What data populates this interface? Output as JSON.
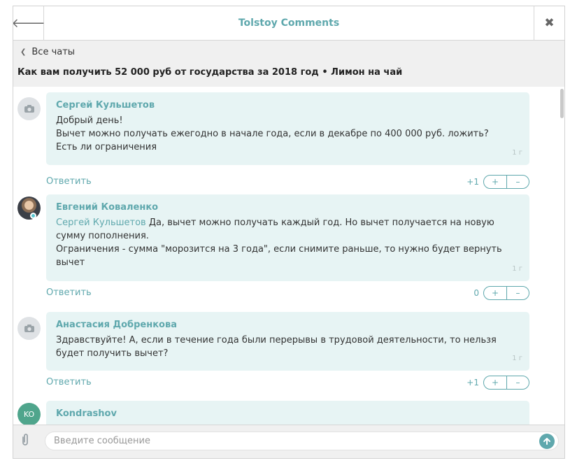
{
  "titlebar": {
    "back_icon": "arrow-left-icon",
    "title": "Tolstoy Comments",
    "close_icon": "close-icon"
  },
  "subheader": {
    "back_label": "Все чаты",
    "chat_title": "Как вам получить 52 000 руб от государства за 2018 год • Лимон на чай"
  },
  "messages": [
    {
      "author": "Сергей Кульшетов",
      "lines": [
        "Добрый день!",
        "Вычет можно получать ежегодно в начале года, если в декабре по 400 000 руб. ложить?",
        "Есть ли ограничения"
      ],
      "time": "1 г",
      "reply": "Ответить",
      "score": "+1",
      "plus": "+",
      "minus": "–"
    },
    {
      "author": "Евгений Коваленко",
      "mention": "Сергей Кульшетов",
      "text": " Да, вычет можно получать каждый год. Но вычет получается на новую сумму пополнения.",
      "text2": "Ограничения - сумма \"морозится на 3 года\", если снимите раньше, то нужно будет вернуть вычет",
      "time": "1 г",
      "reply": "Ответить",
      "score": "0",
      "plus": "+",
      "minus": "–"
    },
    {
      "author": "Анастасия Добренкова",
      "lines": [
        "Здравствуйте! А, если в течение года были перерывы в трудовой деятельности, то нельзя будет получить вычет?"
      ],
      "time": "1 г",
      "reply": "Ответить",
      "score": "+1",
      "plus": "+",
      "minus": "–"
    },
    {
      "author": "Kondrashov",
      "avatar_initials": "KO"
    }
  ],
  "composer": {
    "placeholder": "Введите сообщение",
    "attach_icon": "paperclip-icon",
    "send_icon": "send-arrow-icon"
  },
  "colors": {
    "accent": "#5fa8ad",
    "bubble": "#e7f4f4",
    "header_bg": "#f0f0f0"
  }
}
